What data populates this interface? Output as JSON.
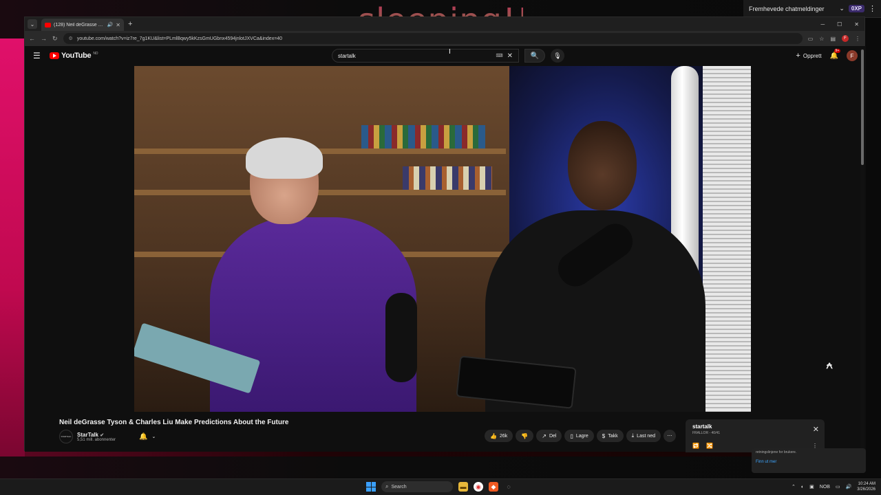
{
  "overlay": {
    "text": "sleeping!!"
  },
  "chat_widget": {
    "label": "Fremhevede chatmeldinger",
    "points": "0XP"
  },
  "browser": {
    "tab_title": "(128) Neil deGrasse Tyson &",
    "url": "youtube.com/watch?v=iz7re_7g1KU&list=PLmlBqwy5kKzsGmUGbnx4594jnlotJXVCa&index=40",
    "profile_initial": "F"
  },
  "youtube": {
    "logo_text": "YouTube",
    "logo_country": "NO",
    "search_value": "startalk",
    "create_label": "Opprett",
    "notification_count": "9+",
    "avatar_initial": "F"
  },
  "video": {
    "title": "Neil deGrasse Tyson & Charles Liu Make Predictions About the Future",
    "channel_avatar_text": "STARTALK",
    "channel_name": "StarTalk",
    "verified": "✔",
    "subscribers": "5,51 mill. abonnenter",
    "likes": "26k",
    "share_label": "Del",
    "save_label": "Lagre",
    "thanks_label": "Takk",
    "download_label": "Last ned"
  },
  "playlist": {
    "title": "startalk",
    "subtitle": "FRALLOR - 40/41"
  },
  "notice": {
    "text": "retningslinjene for brukere.",
    "link": "Finn ut mer"
  },
  "taskbar": {
    "search_placeholder": "Search",
    "lang": "NOB",
    "time": "10:24 AM",
    "date": "3/26/2026"
  }
}
